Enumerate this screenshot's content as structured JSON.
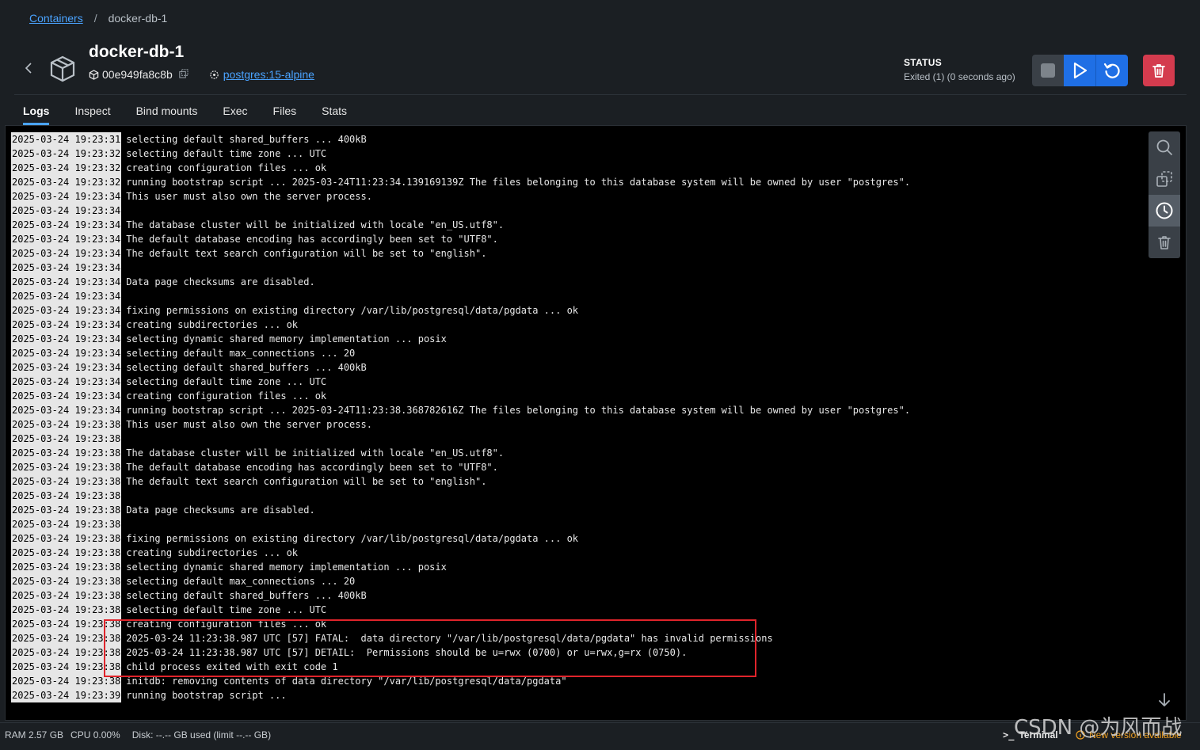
{
  "breadcrumb": {
    "parent": "Containers",
    "separator": "/",
    "current": "docker-db-1"
  },
  "container": {
    "name": "docker-db-1",
    "id": "00e949fa8c8b",
    "image": "postgres:15-alpine"
  },
  "status": {
    "label": "STATUS",
    "value": "Exited (1) (0 seconds ago)"
  },
  "controls": {
    "stop_icon": "stop-icon",
    "start_icon": "play-icon",
    "restart_icon": "restart-icon",
    "delete_icon": "trash-icon"
  },
  "colors": {
    "accent": "#1f6fe5",
    "link": "#4aa3ff",
    "danger": "#d43b4e",
    "highlight_box": "#e0242b"
  },
  "tabs": [
    {
      "label": "Logs",
      "active": true
    },
    {
      "label": "Inspect"
    },
    {
      "label": "Bind mounts"
    },
    {
      "label": "Exec"
    },
    {
      "label": "Files"
    },
    {
      "label": "Stats"
    }
  ],
  "logs": [
    {
      "ts": "2025-03-24 19:23:31",
      "msg": "selecting default shared_buffers ... 400kB"
    },
    {
      "ts": "2025-03-24 19:23:32",
      "msg": "selecting default time zone ... UTC"
    },
    {
      "ts": "2025-03-24 19:23:32",
      "msg": "creating configuration files ... ok"
    },
    {
      "ts": "2025-03-24 19:23:32",
      "msg": "running bootstrap script ... 2025-03-24T11:23:34.139169139Z The files belonging to this database system will be owned by user \"postgres\"."
    },
    {
      "ts": "2025-03-24 19:23:34",
      "msg": "This user must also own the server process."
    },
    {
      "ts": "2025-03-24 19:23:34",
      "msg": ""
    },
    {
      "ts": "2025-03-24 19:23:34",
      "msg": "The database cluster will be initialized with locale \"en_US.utf8\"."
    },
    {
      "ts": "2025-03-24 19:23:34",
      "msg": "The default database encoding has accordingly been set to \"UTF8\"."
    },
    {
      "ts": "2025-03-24 19:23:34",
      "msg": "The default text search configuration will be set to \"english\"."
    },
    {
      "ts": "2025-03-24 19:23:34",
      "msg": ""
    },
    {
      "ts": "2025-03-24 19:23:34",
      "msg": "Data page checksums are disabled."
    },
    {
      "ts": "2025-03-24 19:23:34",
      "msg": ""
    },
    {
      "ts": "2025-03-24 19:23:34",
      "msg": "fixing permissions on existing directory /var/lib/postgresql/data/pgdata ... ok"
    },
    {
      "ts": "2025-03-24 19:23:34",
      "msg": "creating subdirectories ... ok"
    },
    {
      "ts": "2025-03-24 19:23:34",
      "msg": "selecting dynamic shared memory implementation ... posix"
    },
    {
      "ts": "2025-03-24 19:23:34",
      "msg": "selecting default max_connections ... 20"
    },
    {
      "ts": "2025-03-24 19:23:34",
      "msg": "selecting default shared_buffers ... 400kB"
    },
    {
      "ts": "2025-03-24 19:23:34",
      "msg": "selecting default time zone ... UTC"
    },
    {
      "ts": "2025-03-24 19:23:34",
      "msg": "creating configuration files ... ok"
    },
    {
      "ts": "2025-03-24 19:23:34",
      "msg": "running bootstrap script ... 2025-03-24T11:23:38.368782616Z The files belonging to this database system will be owned by user \"postgres\"."
    },
    {
      "ts": "2025-03-24 19:23:38",
      "msg": "This user must also own the server process."
    },
    {
      "ts": "2025-03-24 19:23:38",
      "msg": ""
    },
    {
      "ts": "2025-03-24 19:23:38",
      "msg": "The database cluster will be initialized with locale \"en_US.utf8\"."
    },
    {
      "ts": "2025-03-24 19:23:38",
      "msg": "The default database encoding has accordingly been set to \"UTF8\"."
    },
    {
      "ts": "2025-03-24 19:23:38",
      "msg": "The default text search configuration will be set to \"english\"."
    },
    {
      "ts": "2025-03-24 19:23:38",
      "msg": ""
    },
    {
      "ts": "2025-03-24 19:23:38",
      "msg": "Data page checksums are disabled."
    },
    {
      "ts": "2025-03-24 19:23:38",
      "msg": ""
    },
    {
      "ts": "2025-03-24 19:23:38",
      "msg": "fixing permissions on existing directory /var/lib/postgresql/data/pgdata ... ok"
    },
    {
      "ts": "2025-03-24 19:23:38",
      "msg": "creating subdirectories ... ok"
    },
    {
      "ts": "2025-03-24 19:23:38",
      "msg": "selecting dynamic shared memory implementation ... posix"
    },
    {
      "ts": "2025-03-24 19:23:38",
      "msg": "selecting default max_connections ... 20"
    },
    {
      "ts": "2025-03-24 19:23:38",
      "msg": "selecting default shared_buffers ... 400kB"
    },
    {
      "ts": "2025-03-24 19:23:38",
      "msg": "selecting default time zone ... UTC"
    },
    {
      "ts": "2025-03-24 19:23:38",
      "msg": "creating configuration files ... ok"
    },
    {
      "ts": "2025-03-24 19:23:38",
      "msg": "2025-03-24 11:23:38.987 UTC [57] FATAL:  data directory \"/var/lib/postgresql/data/pgdata\" has invalid permissions"
    },
    {
      "ts": "2025-03-24 19:23:38",
      "msg": "2025-03-24 11:23:38.987 UTC [57] DETAIL:  Permissions should be u=rwx (0700) or u=rwx,g=rx (0750)."
    },
    {
      "ts": "2025-03-24 19:23:38",
      "msg": "child process exited with exit code 1"
    },
    {
      "ts": "2025-03-24 19:23:38",
      "msg": "initdb: removing contents of data directory \"/var/lib/postgresql/data/pgdata\""
    },
    {
      "ts": "2025-03-24 19:23:39",
      "msg": "running bootstrap script ..."
    }
  ],
  "side_tools": [
    "search-icon",
    "copy-icon",
    "clock-icon",
    "trash-icon"
  ],
  "footer": {
    "ram": "RAM 2.57 GB",
    "cpu": "CPU 0.00%",
    "disk": "Disk: --.-- GB used (limit --.-- GB)",
    "terminal": "Terminal",
    "new_version": "New version available"
  },
  "watermark": "CSDN @为风而战"
}
